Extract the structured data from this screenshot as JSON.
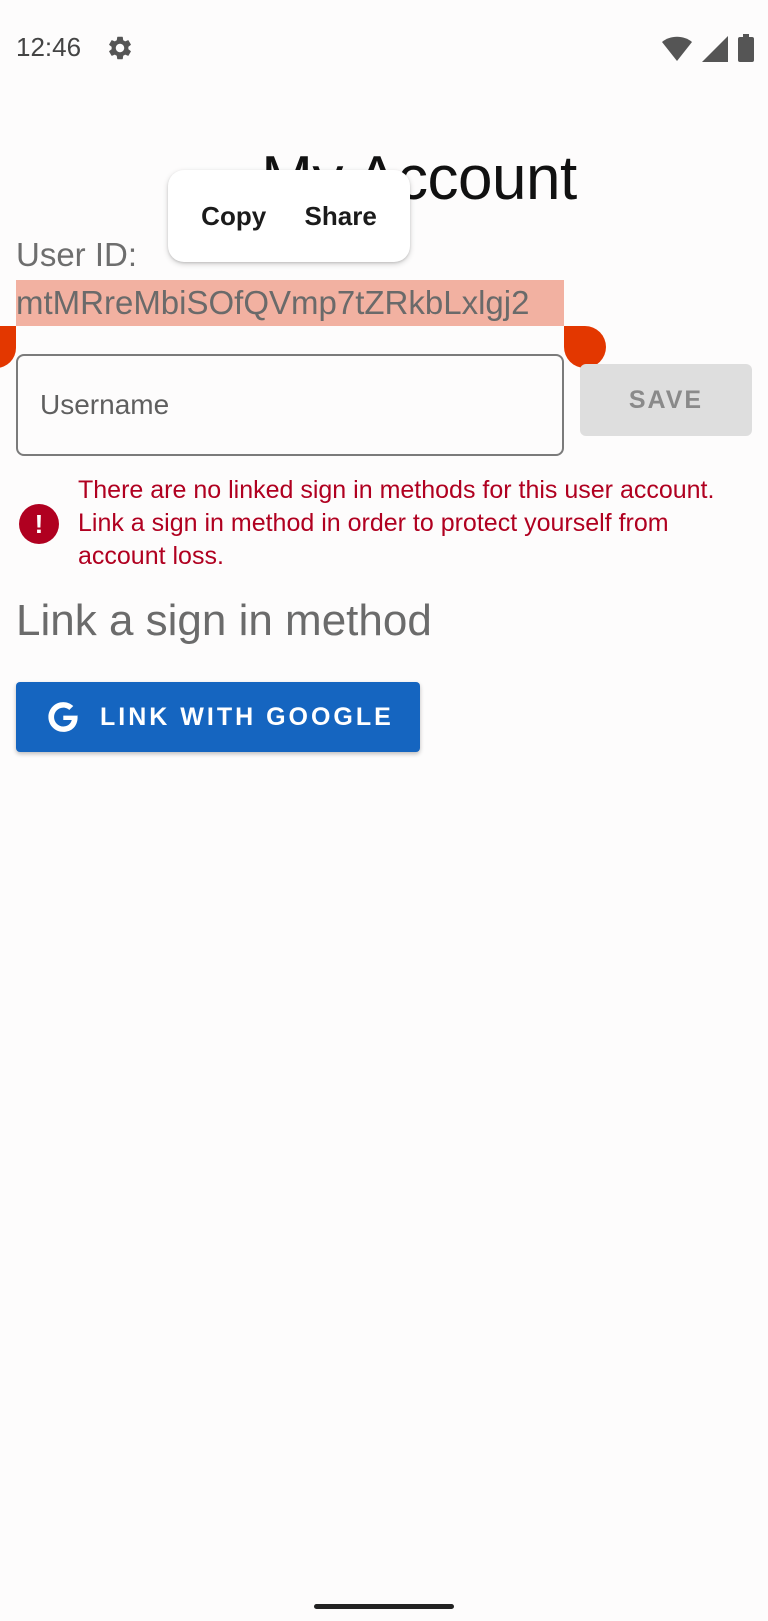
{
  "status_bar": {
    "time": "12:46",
    "icons": [
      "gear-icon",
      "wifi-icon",
      "signal-icon",
      "battery-icon"
    ]
  },
  "header": {
    "title": "My Account"
  },
  "context_menu": {
    "items": [
      "Copy",
      "Share"
    ]
  },
  "user": {
    "id_label": "User ID:",
    "id_value": "mtMRreMbiSOfQVmp7tZRkbLxlgj2"
  },
  "username_form": {
    "placeholder": "Username",
    "value": "",
    "save_label": "SAVE"
  },
  "warning": {
    "message": "There are no linked sign in methods for this user account. Link a sign in method in order to protect yourself from account loss."
  },
  "link_section": {
    "title": "Link a sign in method",
    "google_button_label": "LINK WITH GOOGLE"
  },
  "colors": {
    "accent": "#1565c0",
    "error": "#b00020",
    "selection": "#f2b1a1",
    "selection_handle": "#e33700"
  }
}
